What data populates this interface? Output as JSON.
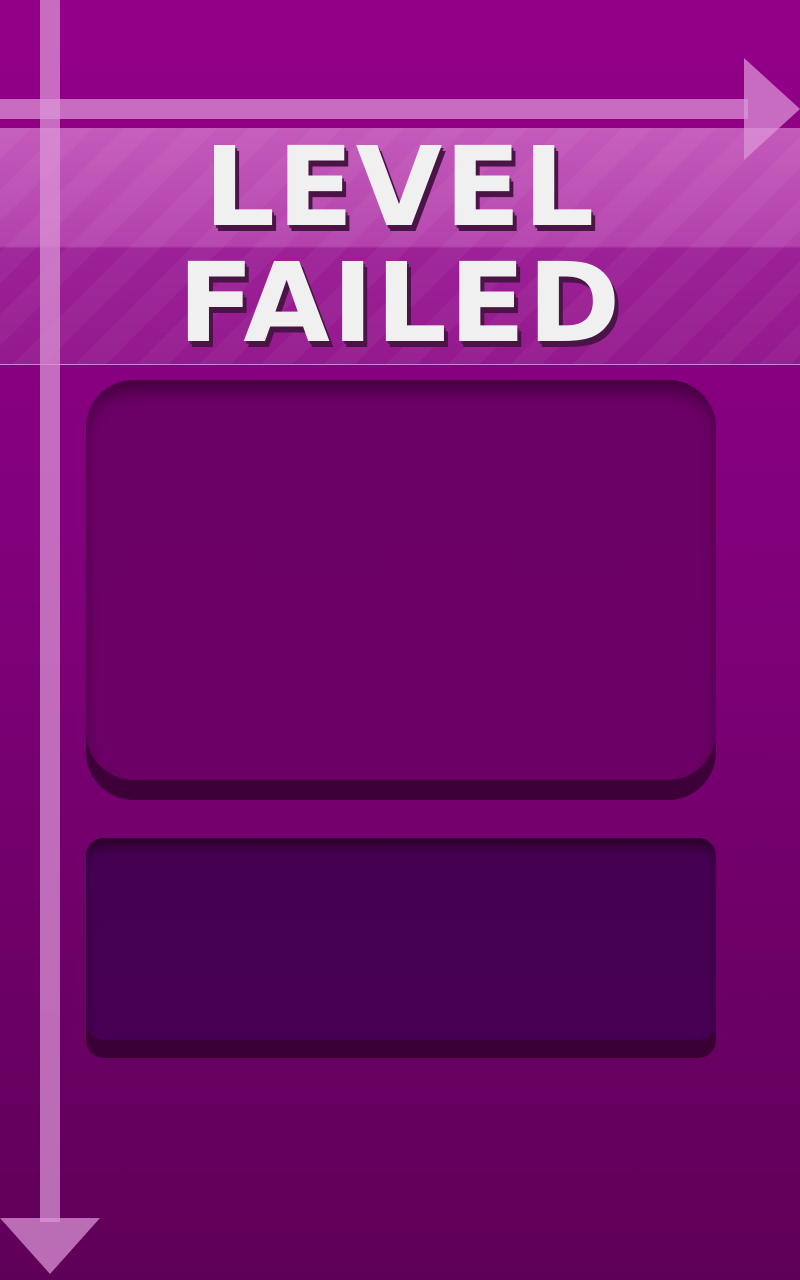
{
  "screen": {
    "name": "level-failed-screen"
  },
  "title": {
    "line1": "LEVEL",
    "line2": "FAILED"
  },
  "colors": {
    "background": "#80007a",
    "title_text": "#f0f0f0",
    "title_shadow": "#4a1447",
    "panel": "#6c0066",
    "panel_dark": "#470054",
    "arrow": "#dc96d7"
  },
  "icons": {
    "horizontal_arrow": "arrow-right-icon",
    "vertical_arrow": "arrow-down-icon"
  }
}
